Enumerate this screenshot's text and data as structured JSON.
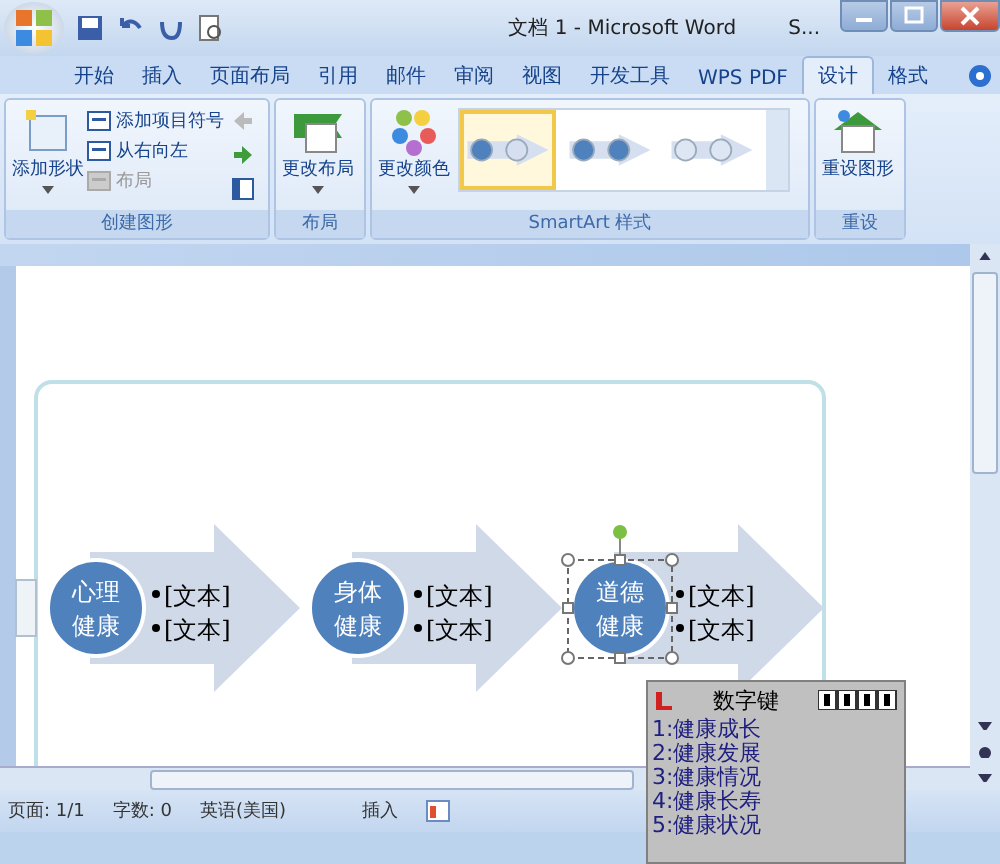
{
  "window": {
    "title": "文档 1 - Microsoft Word",
    "other_window": "S..."
  },
  "tabs": [
    {
      "label": "开始",
      "selected": false
    },
    {
      "label": "插入",
      "selected": false
    },
    {
      "label": "页面布局",
      "selected": false
    },
    {
      "label": "引用",
      "selected": false
    },
    {
      "label": "邮件",
      "selected": false
    },
    {
      "label": "审阅",
      "selected": false
    },
    {
      "label": "视图",
      "selected": false
    },
    {
      "label": "开发工具",
      "selected": false
    },
    {
      "label": "WPS PDF",
      "selected": false
    },
    {
      "label": "设计",
      "selected": true
    },
    {
      "label": "格式",
      "selected": false
    }
  ],
  "ribbon": {
    "groups": [
      {
        "kind": "create",
        "label": "创建图形",
        "large": "添加形状",
        "small": [
          {
            "label": "添加项目符号",
            "disabled": false
          },
          {
            "label": "从右向左",
            "disabled": false
          },
          {
            "label": "布局",
            "disabled": true
          }
        ]
      },
      {
        "kind": "layout",
        "label": "布局",
        "large": "更改布局"
      },
      {
        "kind": "styles",
        "label": "SmartArt 样式",
        "large": "更改颜色",
        "styles": [
          {
            "selected": true
          },
          {
            "selected": false
          },
          {
            "selected": false
          }
        ]
      },
      {
        "kind": "reset",
        "label": "重设",
        "large": "重设图形"
      }
    ]
  },
  "smartart": {
    "items": [
      {
        "title": [
          "心理",
          "健康"
        ],
        "bullets": [
          "[文本]",
          "[文本]"
        ],
        "selected": false
      },
      {
        "title": [
          "身体",
          "健康"
        ],
        "bullets": [
          "[文本]",
          "[文本]"
        ],
        "selected": false
      },
      {
        "title": [
          "道德",
          "健康"
        ],
        "bullets": [
          "[文本]",
          "[文本]"
        ],
        "selected": true
      }
    ]
  },
  "ime": {
    "title": "数字键",
    "candidates": [
      "1:健康成长",
      "2:健康发展",
      "3:健康情况",
      "4:健康长寿",
      "5:健康状况"
    ]
  },
  "status_bar": {
    "page": "页面: 1/1",
    "words": "字数: 0",
    "language": "英语(美国)",
    "mode": "插入"
  }
}
